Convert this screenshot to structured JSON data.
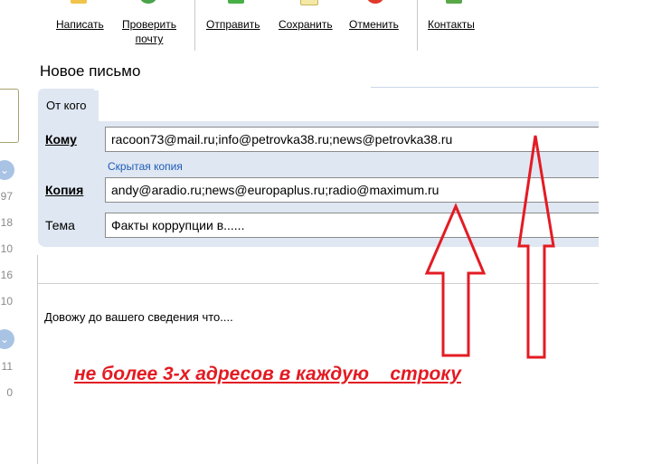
{
  "toolbar": {
    "compose": "Написать",
    "check_line1": "Проверить",
    "check_line2": "почту",
    "send": "Отправить",
    "save": "Сохранить",
    "cancel": "Отменить",
    "contacts": "Контакты"
  },
  "sidebar": {
    "counts_group1": [
      "97",
      "18",
      "10",
      "16",
      "10"
    ],
    "counts_group2": [
      "11",
      "0"
    ]
  },
  "compose": {
    "title": "Новое письмо",
    "from_label": "От кого",
    "to_label": "Кому",
    "to_value": "racoon73@mail.ru;info@petrovka38.ru;news@petrovka38.ru",
    "bcc_link": "Скрытая копия",
    "cc_label": "Копия",
    "cc_value": "andy@aradio.ru;news@europaplus.ru;radio@maximum.ru",
    "subject_label": "Тема",
    "subject_value": "Факты коррупции в......",
    "body": "Довожу до вашего сведения  что...."
  },
  "annotation": {
    "text": "не более 3-х адресов в каждую    строку",
    "color": "#e31b23"
  },
  "colors": {
    "panel": "#dfe7f2",
    "link": "#1f5cb5",
    "accent_arrow": "#e31b23"
  }
}
